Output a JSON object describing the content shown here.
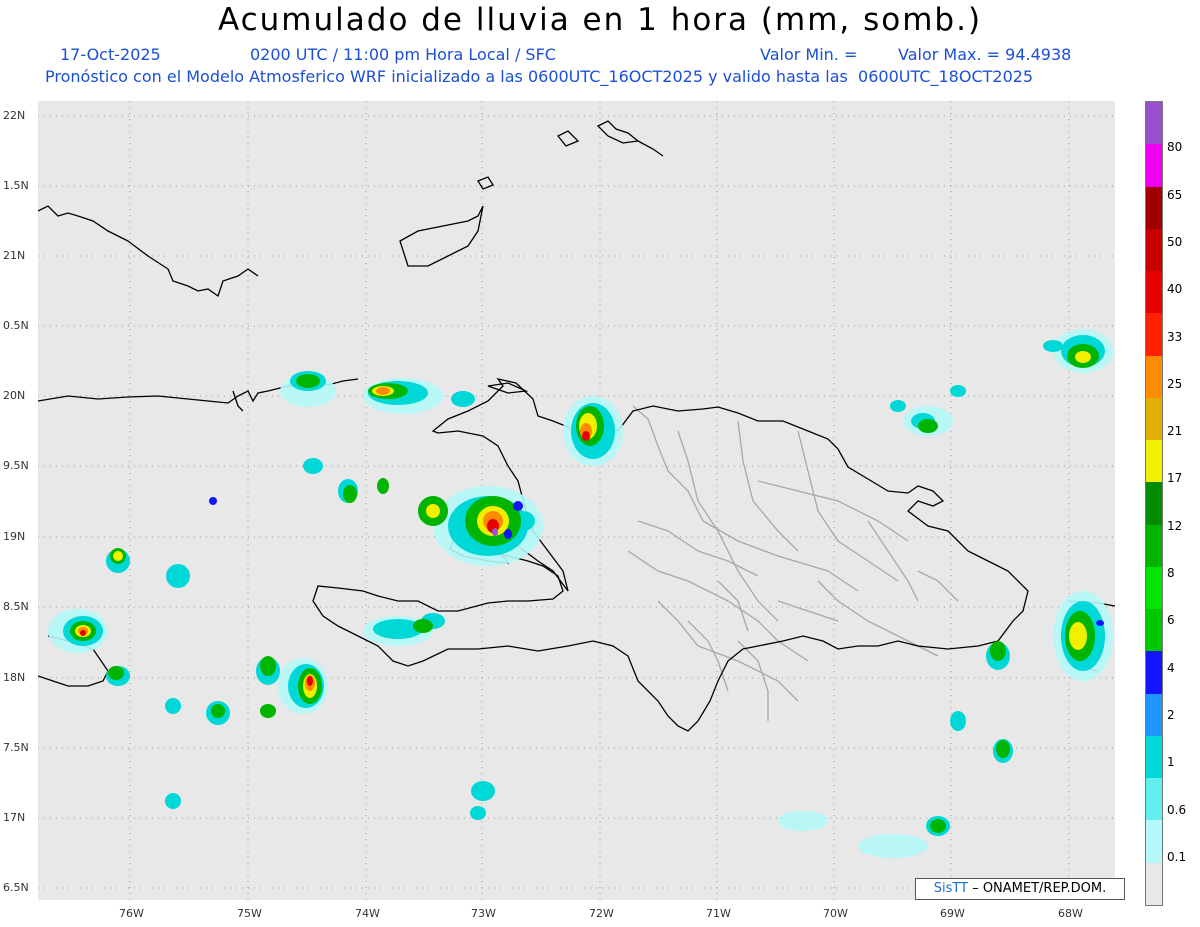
{
  "header": {
    "title": "Acumulado de lluvia en 1 hora (mm, somb.)",
    "date": "17-Oct-2025",
    "time_info": "0200 UTC / 11:00 pm Hora Local / SFC",
    "min_label": "Valor Min. =",
    "max_label": "Valor Max. = 94.4938",
    "forecast_info": "Pronóstico con el Modelo Atmosferico WRF inicializado a las 0600UTC_16OCT2025 y valido hasta las  0600UTC_18OCT2025"
  },
  "axes": {
    "lat_labels": [
      "22N",
      "1.5N",
      "21N",
      "0.5N",
      "20N",
      "9.5N",
      "19N",
      "8.5N",
      "18N",
      "7.5N",
      "17N",
      "6.5N"
    ],
    "lon_labels": [
      "76W",
      "75W",
      "74W",
      "73W",
      "72W",
      "71W",
      "70W",
      "69W",
      "68W"
    ]
  },
  "legend": {
    "labels": [
      "80",
      "65",
      "50",
      "40",
      "33",
      "25",
      "21",
      "17",
      "12",
      "8",
      "6",
      "4",
      "2",
      "1",
      "0.6",
      "0.1"
    ],
    "colors": [
      "#9a4fd0",
      "#f000f0",
      "#a00000",
      "#c80000",
      "#e60000",
      "#ff2000",
      "#ff8c00",
      "#e0b000",
      "#f0f000",
      "#008c00",
      "#00b400",
      "#00e600",
      "#00c800",
      "#1414ff",
      "#1e96ff",
      "#00d8d8",
      "#60f0f0",
      "#b4f8f8",
      "#e8e8e8"
    ]
  },
  "credit": {
    "brand": "SisTT",
    "text": " – ONAMET/REP.DOM."
  }
}
